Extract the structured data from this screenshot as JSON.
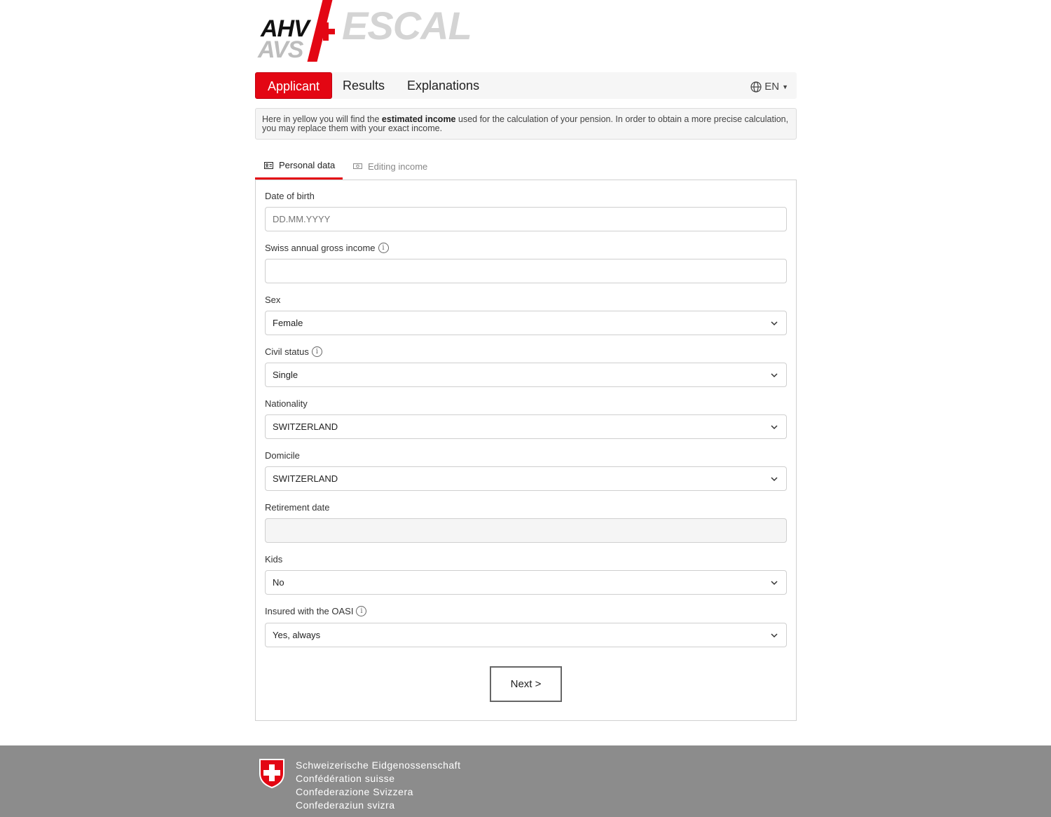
{
  "logo": {
    "line1": "AHV",
    "line2": "AVS",
    "product": "ESCAL"
  },
  "nav": {
    "tabs": [
      {
        "label": "Applicant"
      },
      {
        "label": "Results"
      },
      {
        "label": "Explanations"
      }
    ],
    "language": "EN"
  },
  "info": {
    "text_before": "Here in yellow you will find the ",
    "text_bold": "estimated income",
    "text_after": " used for the calculation of your pension. In order to obtain a more precise calculation, you may replace them with your exact income."
  },
  "subtabs": [
    {
      "label": "Personal data",
      "icon": "id-card-icon"
    },
    {
      "label": "Editing income",
      "icon": "money-icon"
    }
  ],
  "form": {
    "date_of_birth": {
      "label": "Date of birth",
      "placeholder": "DD.MM.YYYY"
    },
    "income": {
      "label": "Swiss annual gross income",
      "value": ""
    },
    "sex": {
      "label": "Sex",
      "value": "Female"
    },
    "civil_status": {
      "label": "Civil status",
      "value": "Single"
    },
    "nationality": {
      "label": "Nationality",
      "value": "SWITZERLAND"
    },
    "domicile": {
      "label": "Domicile",
      "value": "SWITZERLAND"
    },
    "retirement_date": {
      "label": "Retirement date",
      "value": ""
    },
    "kids": {
      "label": "Kids",
      "value": "No"
    },
    "insured": {
      "label": "Insured with the OASI",
      "value": "Yes, always"
    },
    "next_label": "Next >"
  },
  "footer": {
    "lines": [
      "Schweizerische Eidgenossenschaft",
      "Confédération suisse",
      "Confederazione Svizzera",
      "Confederaziun svizra"
    ]
  },
  "colors": {
    "accent": "#e30613",
    "footer_bg": "#8c8c8c"
  }
}
